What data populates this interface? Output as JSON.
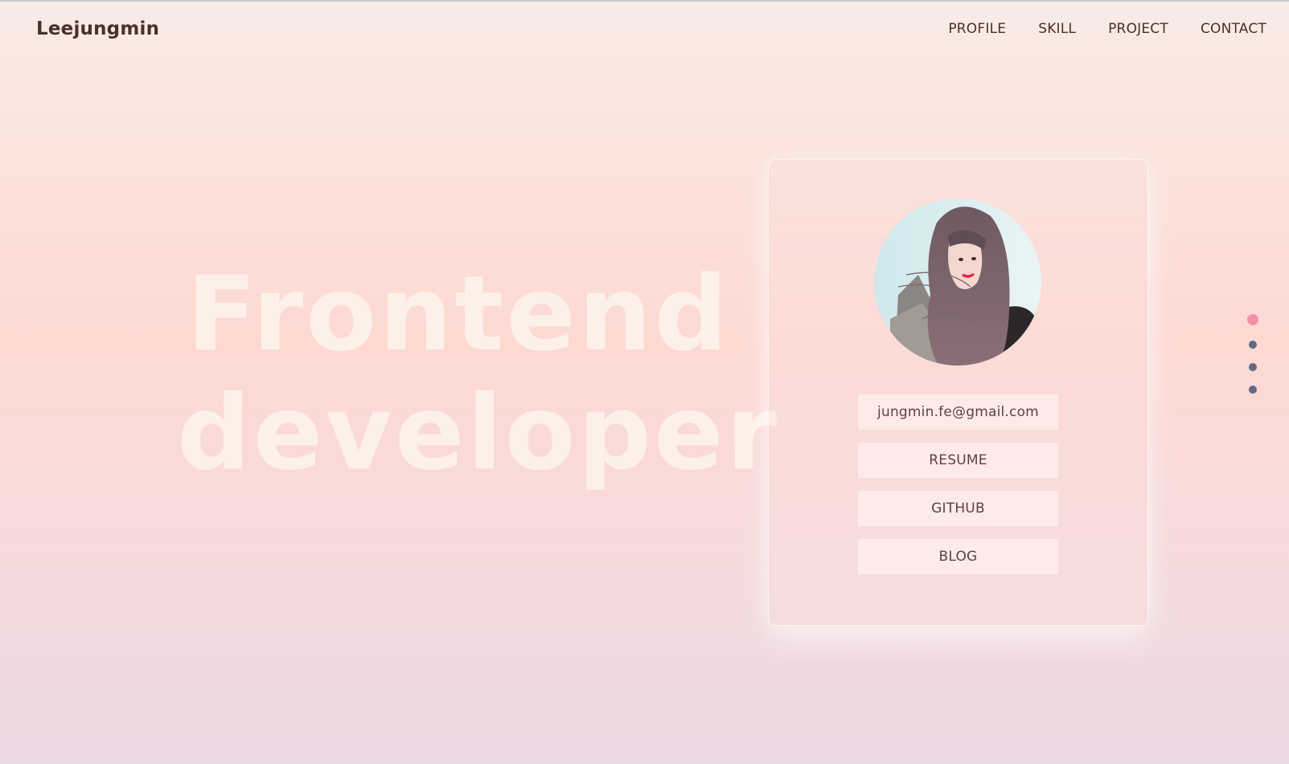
{
  "header": {
    "brand": "Leejungmin",
    "nav": [
      "PROFILE",
      "SKILL",
      "PROJECT",
      "CONTACT"
    ]
  },
  "hero": {
    "line1": "Frontend",
    "line2": "developer"
  },
  "profile_card": {
    "email": "jungmin.fe@gmail.com",
    "buttons": [
      "RESUME",
      "GITHUB",
      "BLOG"
    ]
  },
  "pagination": {
    "count": 4,
    "active_index": 0
  },
  "colors": {
    "text_dark": "#4b302a",
    "hero_text": "#fdf0e8",
    "dot_active": "#f590ad",
    "dot_inactive": "#5e6988"
  }
}
